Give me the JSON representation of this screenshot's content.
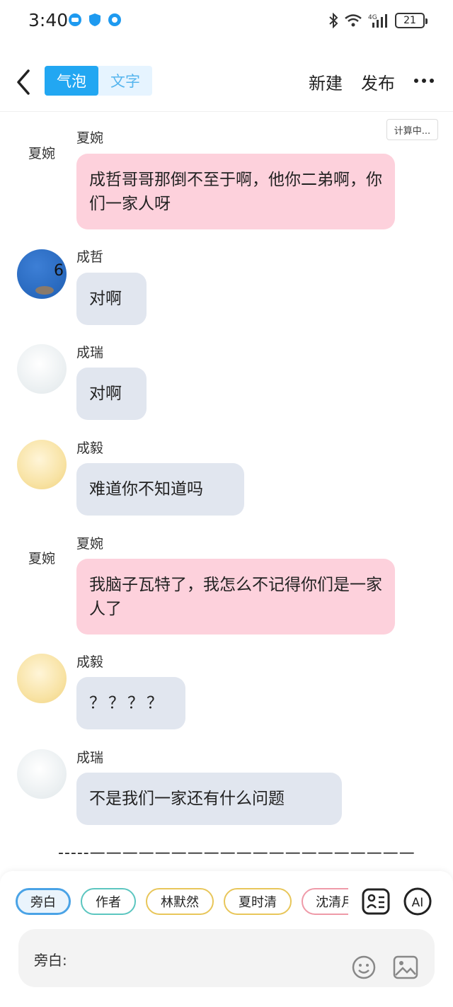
{
  "status_bar": {
    "time": "3:40",
    "battery": "21",
    "network": "4G"
  },
  "header": {
    "tabs": [
      {
        "label": "气泡"
      },
      {
        "label": "文字"
      }
    ],
    "new_label": "新建",
    "publish_label": "发布"
  },
  "calc_badge": "计算中...",
  "messages": [
    {
      "sender": "夏婉",
      "avatar_text": "夏婉",
      "text": "成哲哥哥那倒不至于啊，他你二弟啊，你们一家人呀",
      "color": "#fdd1dc"
    },
    {
      "sender": "成哲",
      "avatar_label": "6",
      "text": "对啊",
      "color": "#e1e6ef"
    },
    {
      "sender": "成瑞",
      "text": "对啊",
      "color": "#e1e6ef"
    },
    {
      "sender": "成毅",
      "text": "难道你不知道吗",
      "color": "#e1e6ef"
    },
    {
      "sender": "夏婉",
      "avatar_text": "夏婉",
      "text": "我脑子瓦特了，我怎么不记得你们是一家人了",
      "color": "#fdd1dc"
    },
    {
      "sender": "成毅",
      "text": "？？？？",
      "color": "#e1e6ef"
    },
    {
      "sender": "成瑞",
      "text": "不是我们一家还有什么问题",
      "color": "#e1e6ef"
    }
  ],
  "dash_line": "-----————————————————————",
  "bottom": {
    "chips": [
      {
        "label": "旁白",
        "color": "#4aa3e6"
      },
      {
        "label": "作者",
        "color": "#5cc6c0"
      },
      {
        "label": "林默然",
        "color": "#e8c65a"
      },
      {
        "label": "夏时清",
        "color": "#e8c65a"
      },
      {
        "label": "沈清月",
        "color": "#ef9aa8"
      }
    ],
    "ai_label": "AI",
    "input_label": "旁白:"
  },
  "icons": [
    "back-arrow-icon",
    "more-icon",
    "contact-card-icon",
    "emoji-icon",
    "image-icon",
    "bluetooth-icon",
    "wifi-icon",
    "signal-icon",
    "battery-icon"
  ]
}
